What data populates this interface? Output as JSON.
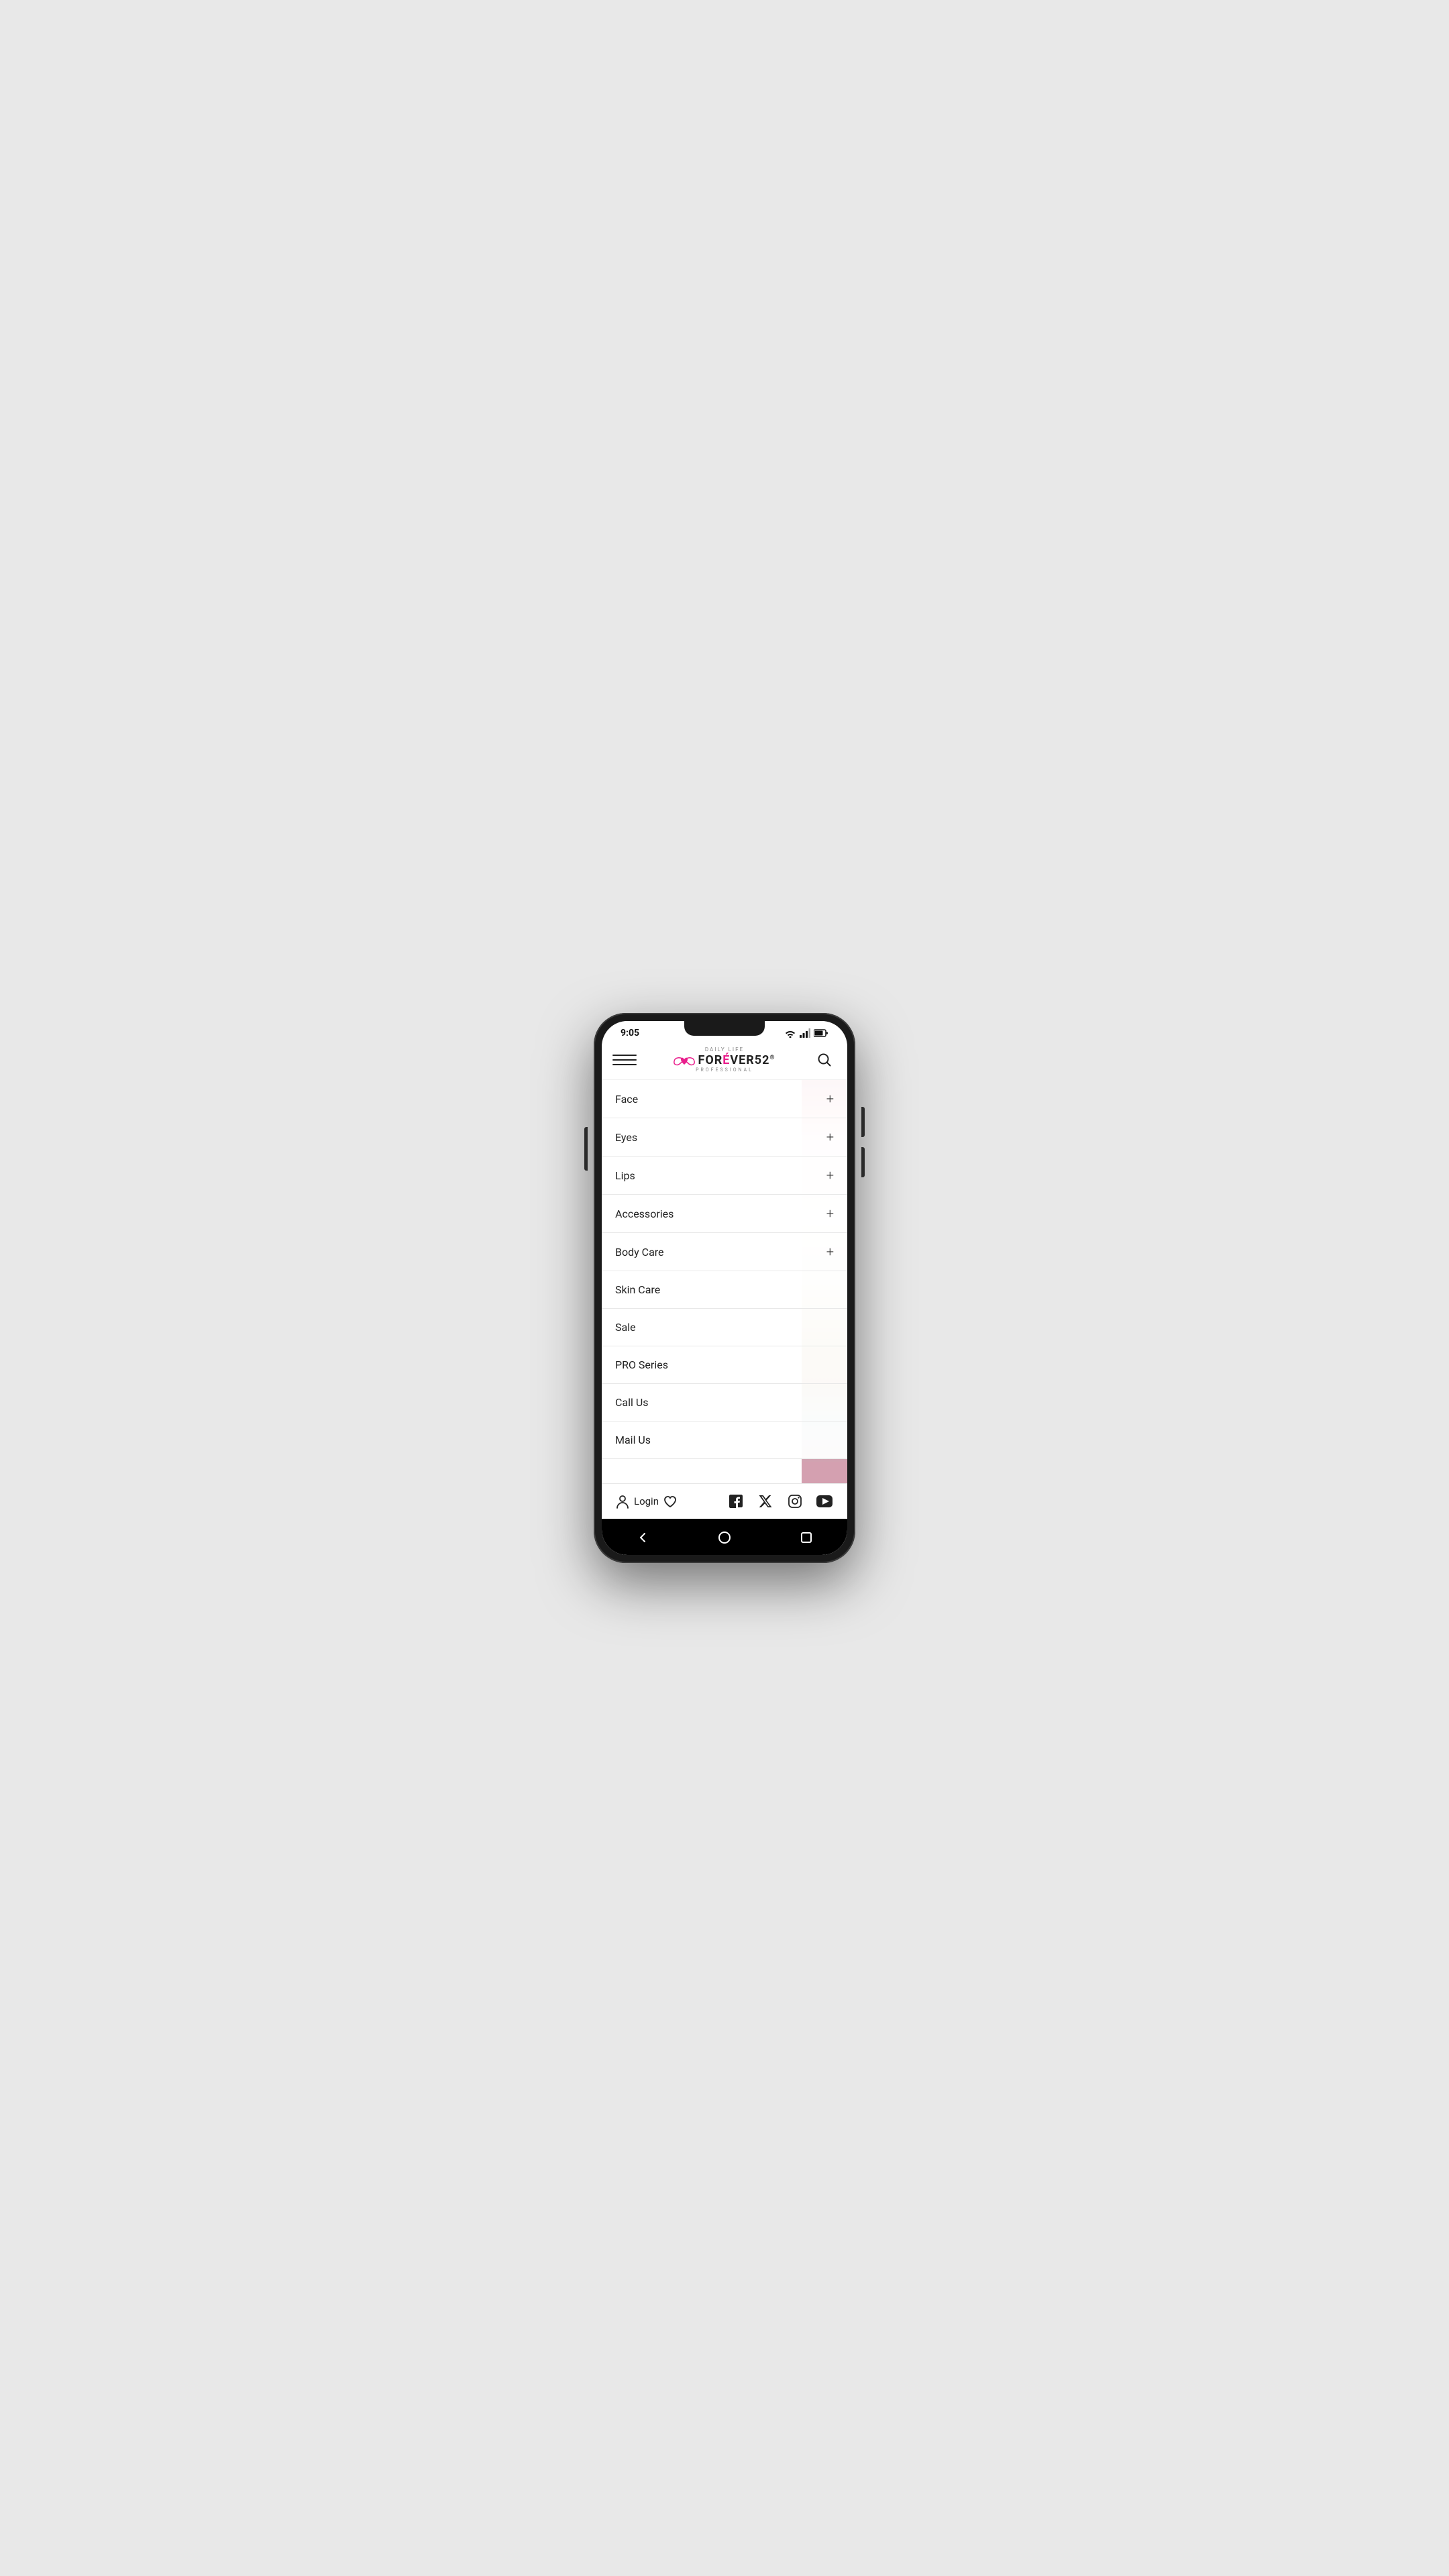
{
  "status": {
    "time": "9:05",
    "wifi": "wifi-icon",
    "signal": "signal-icon",
    "battery": "battery-icon"
  },
  "navbar": {
    "menu_icon": "menu-icon",
    "logo_daily": "Daily life",
    "logo_brand": "FORÉVER52",
    "logo_reg": "®",
    "logo_sub": "PROFESSIONAL",
    "search_icon": "search-icon"
  },
  "menu_items": [
    {
      "label": "Face",
      "has_plus": true
    },
    {
      "label": "Eyes",
      "has_plus": true
    },
    {
      "label": "Lips",
      "has_plus": true
    },
    {
      "label": "Accessories",
      "has_plus": true
    },
    {
      "label": "Body Care",
      "has_plus": true
    },
    {
      "label": "Skin Care",
      "has_plus": false
    },
    {
      "label": "Sale",
      "has_plus": false
    },
    {
      "label": "PRO Series",
      "has_plus": false
    },
    {
      "label": "Call Us",
      "has_plus": false
    },
    {
      "label": "Mail Us",
      "has_plus": false
    }
  ],
  "bottom_bar": {
    "login_label": "Login",
    "user_icon": "user-icon",
    "heart_icon": "heart-icon",
    "facebook_icon": "facebook-icon",
    "twitter_x_icon": "twitter-x-icon",
    "instagram_icon": "instagram-icon",
    "youtube_icon": "youtube-icon"
  },
  "android_nav": {
    "back_icon": "back-icon",
    "home_icon": "home-icon",
    "recent_icon": "recent-icon"
  }
}
